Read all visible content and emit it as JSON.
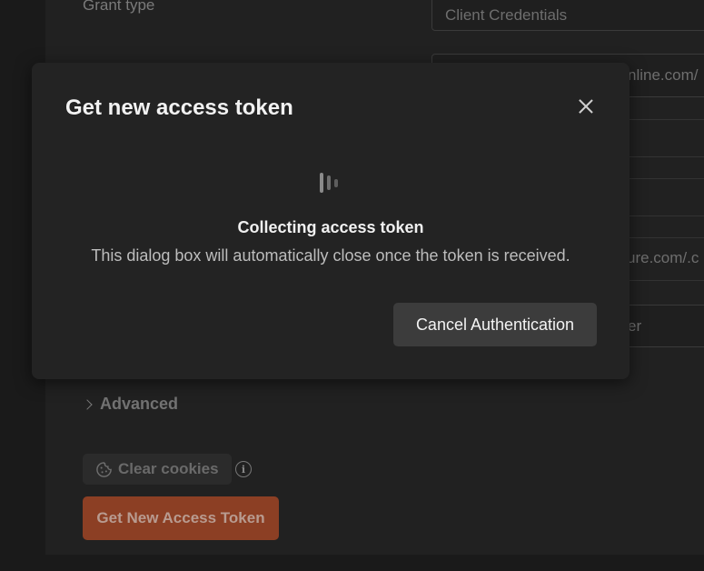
{
  "background": {
    "grant_type_label": "Grant type",
    "grant_type_value": "Client Credentials",
    "field_url_1": "nline.com/",
    "field_url_2": "ure.com/.c",
    "field_partial": "er",
    "advanced_label": "Advanced",
    "clear_cookies_label": "Clear cookies",
    "info_glyph": "i",
    "get_token_label": "Get New Access Token"
  },
  "modal": {
    "title": "Get new access token",
    "status_title": "Collecting access token",
    "status_description": "This dialog box will automatically close once the token is received.",
    "cancel_label": "Cancel Authentication"
  },
  "colors": {
    "accent": "#8c3f24",
    "modal_bg": "#232323",
    "page_bg": "#212121"
  }
}
